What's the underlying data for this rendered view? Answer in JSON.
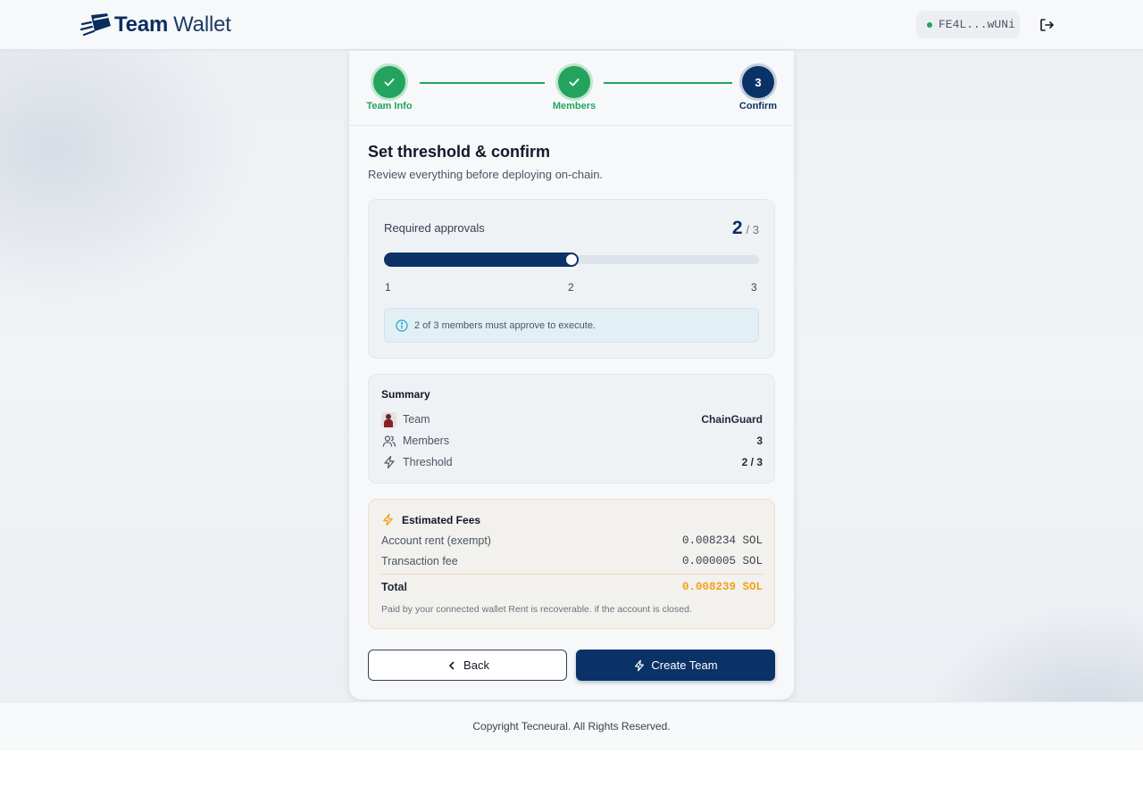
{
  "header": {
    "brand_bold": "Team",
    "brand_light": "Wallet",
    "wallet_address": "FE4L...wUNi",
    "logout_icon": "logout-icon"
  },
  "stepper": {
    "steps": [
      {
        "label": "Team Info",
        "state": "done"
      },
      {
        "label": "Members",
        "state": "done"
      },
      {
        "label": "Confirm",
        "state": "active",
        "number": "3"
      }
    ]
  },
  "main": {
    "title": "Set threshold & confirm",
    "subtitle": "Review everything before deploying on-chain."
  },
  "approvals": {
    "label": "Required approvals",
    "current": "2",
    "total": "/ 3",
    "slider": {
      "min": 1,
      "max": 3,
      "value": 2
    },
    "ticks": [
      "1",
      "2",
      "3"
    ],
    "info": "2 of 3 members must approve to execute."
  },
  "summary": {
    "title": "Summary",
    "rows": [
      {
        "icon": "team-avatar",
        "label": "Team",
        "value": "ChainGuard"
      },
      {
        "icon": "users-icon",
        "label": "Members",
        "value": "3"
      },
      {
        "icon": "bolt-icon",
        "label": "Threshold",
        "value": "2 / 3"
      }
    ]
  },
  "fees": {
    "title": "Estimated Fees",
    "rows": [
      {
        "label": "Account rent (exempt)",
        "amount": "0.008234 SOL"
      },
      {
        "label": "Transaction fee",
        "amount": "0.000005 SOL"
      }
    ],
    "total_label": "Total",
    "total_amount": "0.008239 SOL",
    "note": "Paid by your connected wallet Rent is recoverable. if the account is closed."
  },
  "actions": {
    "back_label": "Back",
    "create_label": "Create Team"
  },
  "footer": {
    "copyright": "Copyright Tecneural. All Rights Reserved."
  },
  "colors": {
    "primary": "#0b3266",
    "success": "#23a35e",
    "warning": "#f0a31a"
  }
}
